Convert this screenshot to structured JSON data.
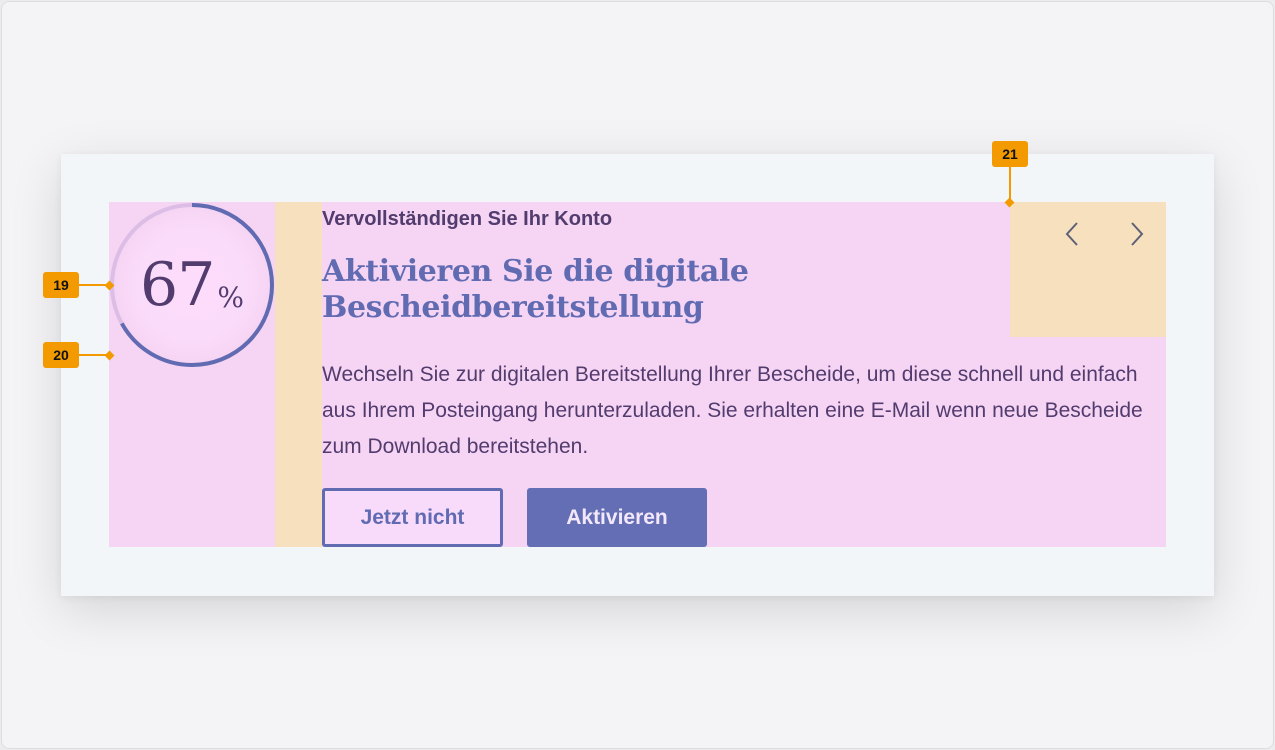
{
  "progress": {
    "percent": 67,
    "number": "67",
    "sign": "%"
  },
  "card": {
    "eyebrow": "Vervollständigen Sie Ihr Konto",
    "title": "Aktivieren Sie die digitale Bescheidbereitstellung",
    "description": "Wechseln Sie zur digitalen Bereitstellung Ihrer Bescheide, um diese schnell und einfach aus Ihrem Posteingang herunterzuladen. Sie erhalten eine E-Mail wenn neue Bescheide zum Download bereitstehen."
  },
  "buttons": {
    "secondary": "Jetzt nicht",
    "primary": "Aktivieren"
  },
  "nav": {
    "prev_icon": "chevron-left-icon",
    "next_icon": "chevron-right-icon"
  },
  "markers": [
    "19",
    "20",
    "21"
  ],
  "colors": {
    "accent": "#616bb2",
    "text": "#523c6e",
    "ring_track": "#dcbde6",
    "ring_fill": "#616bb2",
    "annotation": "#f29a00"
  }
}
